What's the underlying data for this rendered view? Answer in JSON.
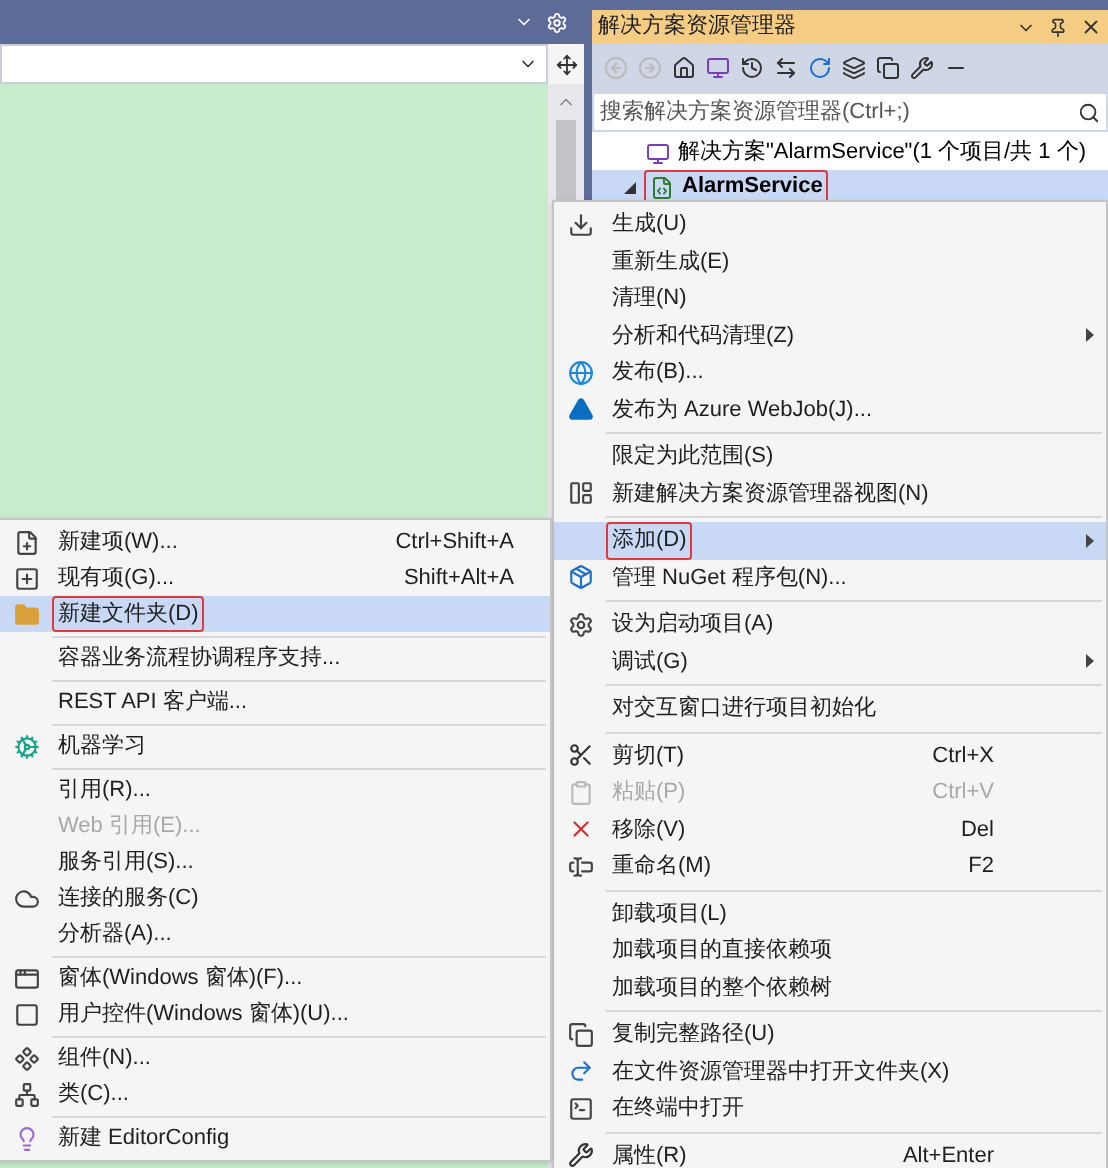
{
  "solution_explorer": {
    "title": "解决方案资源管理器",
    "search": {
      "placeholder": "搜索解决方案资源管理器(Ctrl+;)"
    },
    "tree": [
      {
        "label": "解决方案\"AlarmService\"(1 个项目/共 1 个)",
        "selected": false,
        "outlined": false,
        "children": [
          {
            "label": "AlarmService",
            "selected": true,
            "outlined": true,
            "expanded": true
          }
        ]
      }
    ]
  },
  "context_menu": [
    {
      "kind": "item",
      "label": "生成(U)",
      "submenu": false,
      "disabled": false,
      "selected": false,
      "outlined": false
    },
    {
      "kind": "item",
      "label": "重新生成(E)",
      "submenu": false,
      "disabled": false,
      "selected": false,
      "outlined": false
    },
    {
      "kind": "item",
      "label": "清理(N)",
      "submenu": false,
      "disabled": false,
      "selected": false,
      "outlined": false
    },
    {
      "kind": "item",
      "label": "分析和代码清理(Z)",
      "submenu": true,
      "disabled": false,
      "selected": false,
      "outlined": false
    },
    {
      "kind": "item",
      "label": "发布(B)...",
      "submenu": false,
      "disabled": false,
      "selected": false,
      "outlined": false
    },
    {
      "kind": "item",
      "label": "发布为 Azure WebJob(J)...",
      "submenu": false,
      "disabled": false,
      "selected": false,
      "outlined": false
    },
    {
      "kind": "separator"
    },
    {
      "kind": "item",
      "label": "限定为此范围(S)",
      "submenu": false,
      "disabled": false,
      "selected": false,
      "outlined": false
    },
    {
      "kind": "item",
      "label": "新建解决方案资源管理器视图(N)",
      "submenu": false,
      "disabled": false,
      "selected": false,
      "outlined": false
    },
    {
      "kind": "separator"
    },
    {
      "kind": "item",
      "label": "添加(D)",
      "submenu": true,
      "disabled": false,
      "selected": true,
      "outlined": true
    },
    {
      "kind": "item",
      "label": "管理 NuGet 程序包(N)...",
      "submenu": false,
      "disabled": false,
      "selected": false,
      "outlined": false
    },
    {
      "kind": "separator"
    },
    {
      "kind": "item",
      "label": "设为启动项目(A)",
      "submenu": false,
      "disabled": false,
      "selected": false,
      "outlined": false
    },
    {
      "kind": "item",
      "label": "调试(G)",
      "submenu": true,
      "disabled": false,
      "selected": false,
      "outlined": false
    },
    {
      "kind": "separator"
    },
    {
      "kind": "item",
      "label": "对交互窗口进行项目初始化",
      "submenu": false,
      "disabled": false,
      "selected": false,
      "outlined": false
    },
    {
      "kind": "separator"
    },
    {
      "kind": "item",
      "label": "剪切(T)",
      "shortcut": "Ctrl+X",
      "submenu": false,
      "disabled": false,
      "selected": false,
      "outlined": false
    },
    {
      "kind": "item",
      "label": "粘贴(P)",
      "shortcut": "Ctrl+V",
      "submenu": false,
      "disabled": true,
      "selected": false,
      "outlined": false
    },
    {
      "kind": "item",
      "label": "移除(V)",
      "shortcut": "Del",
      "submenu": false,
      "disabled": false,
      "selected": false,
      "outlined": false
    },
    {
      "kind": "item",
      "label": "重命名(M)",
      "shortcut": "F2",
      "submenu": false,
      "disabled": false,
      "selected": false,
      "outlined": false
    },
    {
      "kind": "separator"
    },
    {
      "kind": "item",
      "label": "卸载项目(L)",
      "submenu": false,
      "disabled": false,
      "selected": false,
      "outlined": false
    },
    {
      "kind": "item",
      "label": "加载项目的直接依赖项",
      "submenu": false,
      "disabled": false,
      "selected": false,
      "outlined": false
    },
    {
      "kind": "item",
      "label": "加载项目的整个依赖树",
      "submenu": false,
      "disabled": false,
      "selected": false,
      "outlined": false
    },
    {
      "kind": "separator"
    },
    {
      "kind": "item",
      "label": "复制完整路径(U)",
      "submenu": false,
      "disabled": false,
      "selected": false,
      "outlined": false
    },
    {
      "kind": "item",
      "label": "在文件资源管理器中打开文件夹(X)",
      "submenu": false,
      "disabled": false,
      "selected": false,
      "outlined": false
    },
    {
      "kind": "item",
      "label": "在终端中打开",
      "submenu": false,
      "disabled": false,
      "selected": false,
      "outlined": false
    },
    {
      "kind": "separator"
    },
    {
      "kind": "item",
      "label": "属性(R)",
      "shortcut": "Alt+Enter",
      "submenu": false,
      "disabled": false,
      "selected": false,
      "outlined": false
    }
  ],
  "add_submenu": [
    {
      "kind": "item",
      "label": "新建项(W)...",
      "shortcut": "Ctrl+Shift+A",
      "submenu": false,
      "disabled": false,
      "selected": false,
      "outlined": false
    },
    {
      "kind": "item",
      "label": "现有项(G)...",
      "shortcut": "Shift+Alt+A",
      "submenu": false,
      "disabled": false,
      "selected": false,
      "outlined": false
    },
    {
      "kind": "item",
      "label": "新建文件夹(D)",
      "submenu": false,
      "disabled": false,
      "selected": true,
      "outlined": true
    },
    {
      "kind": "separator"
    },
    {
      "kind": "item",
      "label": "容器业务流程协调程序支持...",
      "submenu": false,
      "disabled": false,
      "selected": false,
      "outlined": false
    },
    {
      "kind": "separator"
    },
    {
      "kind": "item",
      "label": "REST API 客户端...",
      "submenu": false,
      "disabled": false,
      "selected": false,
      "outlined": false
    },
    {
      "kind": "separator"
    },
    {
      "kind": "item",
      "label": "机器学习",
      "submenu": false,
      "disabled": false,
      "selected": false,
      "outlined": false
    },
    {
      "kind": "separator"
    },
    {
      "kind": "item",
      "label": "引用(R)...",
      "submenu": false,
      "disabled": false,
      "selected": false,
      "outlined": false
    },
    {
      "kind": "item",
      "label": "Web 引用(E)...",
      "submenu": false,
      "disabled": true,
      "selected": false,
      "outlined": false
    },
    {
      "kind": "item",
      "label": "服务引用(S)...",
      "submenu": false,
      "disabled": false,
      "selected": false,
      "outlined": false
    },
    {
      "kind": "item",
      "label": "连接的服务(C)",
      "submenu": false,
      "disabled": false,
      "selected": false,
      "outlined": false
    },
    {
      "kind": "item",
      "label": "分析器(A)...",
      "submenu": false,
      "disabled": false,
      "selected": false,
      "outlined": false
    },
    {
      "kind": "separator"
    },
    {
      "kind": "item",
      "label": "窗体(Windows 窗体)(F)...",
      "submenu": false,
      "disabled": false,
      "selected": false,
      "outlined": false
    },
    {
      "kind": "item",
      "label": "用户控件(Windows 窗体)(U)...",
      "submenu": false,
      "disabled": false,
      "selected": false,
      "outlined": false
    },
    {
      "kind": "separator"
    },
    {
      "kind": "item",
      "label": "组件(N)...",
      "submenu": false,
      "disabled": false,
      "selected": false,
      "outlined": false
    },
    {
      "kind": "item",
      "label": "类(C)...",
      "submenu": false,
      "disabled": false,
      "selected": false,
      "outlined": false
    },
    {
      "kind": "separator"
    },
    {
      "kind": "item",
      "label": "新建 EditorConfig",
      "submenu": false,
      "disabled": false,
      "selected": false,
      "outlined": false
    }
  ]
}
